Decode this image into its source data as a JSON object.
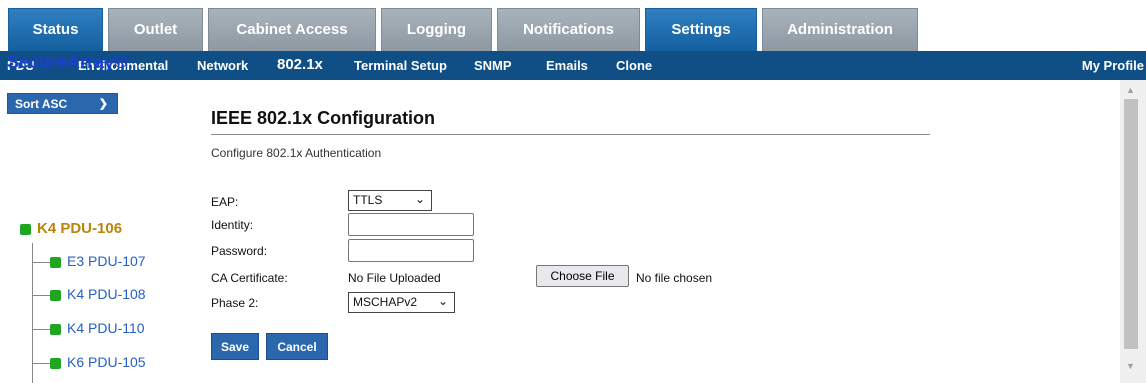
{
  "tabs": [
    "Status",
    "Outlet",
    "Cabinet Access",
    "Logging",
    "Notifications",
    "Settings",
    "Administration"
  ],
  "nav": [
    "PDU",
    "Environmental",
    "Network",
    "802.1x",
    "Terminal Setup",
    "SNMP",
    "Emails",
    "Clone"
  ],
  "nav_right": "My Profile",
  "sidebar": {
    "title": "SecureArray®:",
    "sort_label": "Sort ASC",
    "root": "K4 PDU-106",
    "items": [
      "E3 PDU-107",
      "K4 PDU-108",
      "K4 PDU-110",
      "K6 PDU-105"
    ]
  },
  "main": {
    "title": "IEEE 802.1x Configuration",
    "subtitle": "Configure 802.1x Authentication",
    "labels": {
      "eap": "EAP:",
      "identity": "Identity:",
      "password": "Password:",
      "ca": "CA Certificate:",
      "phase2": "Phase 2:"
    },
    "eap_value": "TTLS",
    "identity_value": "",
    "password_value": "",
    "ca_status": "No File Uploaded",
    "choose_file": "Choose File",
    "no_file": "No file chosen",
    "phase2_value": "MSCHAPv2",
    "save": "Save",
    "cancel": "Cancel"
  }
}
